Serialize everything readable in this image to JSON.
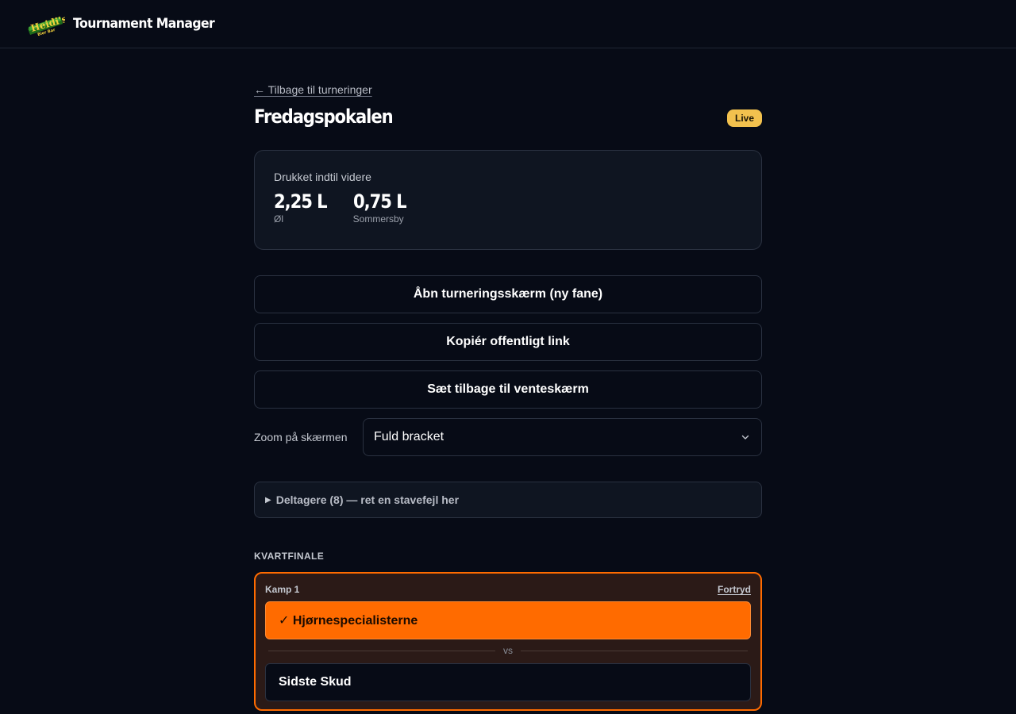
{
  "header": {
    "logo_text": "Heidi's Bier Bar",
    "app_title": "Tournament Manager"
  },
  "page": {
    "back_link": "← Tilbage til turneringer",
    "title": "Fredagspokalen",
    "status": "Live"
  },
  "stats": {
    "label": "Drukket indtil videre",
    "items": [
      {
        "value": "2,25 L",
        "unit": "Øl"
      },
      {
        "value": "0,75 L",
        "unit": "Sommersby"
      }
    ]
  },
  "actions": {
    "open_screen": "Åbn turneringsskærm (ny fane)",
    "copy_link": "Kopiér offentligt link",
    "reset_waiting": "Sæt tilbage til venteskærm"
  },
  "zoom": {
    "label": "Zoom på skærmen",
    "selected": "Fuld bracket"
  },
  "participants": {
    "summary": "Deltagere (8) — ret en stavefejl her"
  },
  "bracket": {
    "round": "KVARTFINALE",
    "match": {
      "label": "Kamp 1",
      "undo": "Fortryd",
      "winner": "✓ Hjørnespecialisterne",
      "vs": "vs",
      "loser": "Sidste Skud"
    }
  },
  "colors": {
    "background": "#070b16",
    "accent": "#ff6b00",
    "badge": "#f2c14e"
  }
}
